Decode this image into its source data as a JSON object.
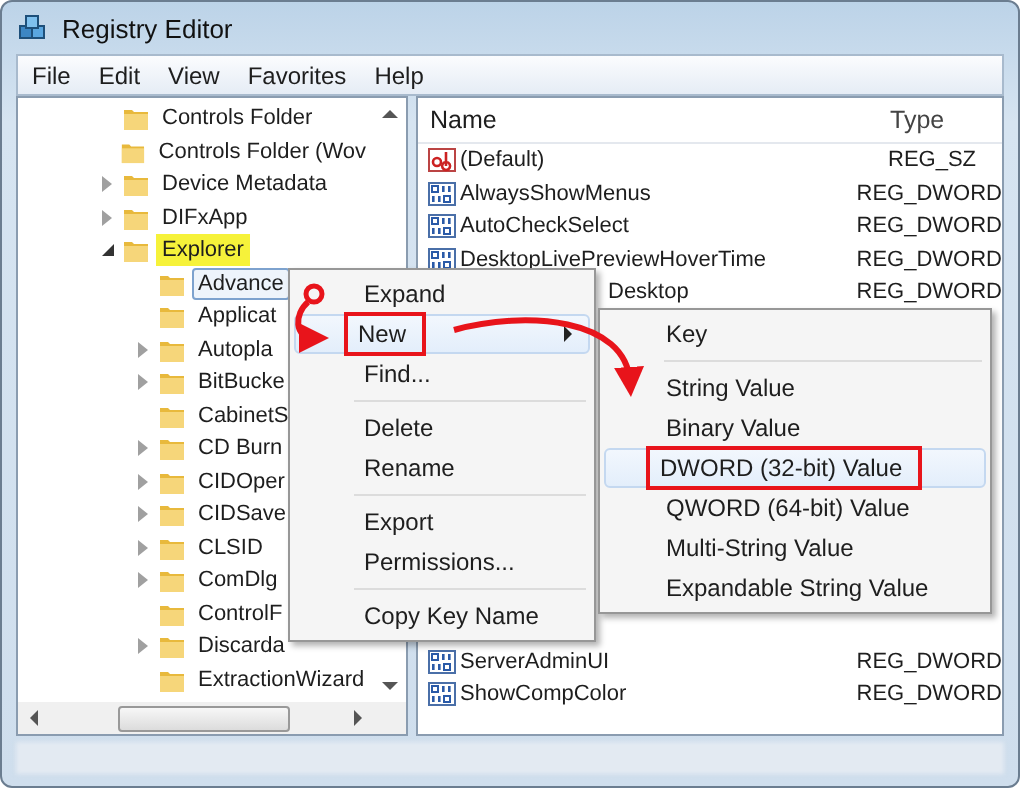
{
  "window": {
    "title": "Registry Editor"
  },
  "menu": [
    "File",
    "Edit",
    "View",
    "Favorites",
    "Help"
  ],
  "tree": [
    {
      "label": "Controls Folder",
      "has_children": false,
      "expanded": false,
      "selected": false,
      "highlighted": false
    },
    {
      "label": "Controls Folder (Wov",
      "has_children": false,
      "expanded": false,
      "selected": false,
      "highlighted": false
    },
    {
      "label": "Device Metadata",
      "has_children": true,
      "expanded": false,
      "selected": false,
      "highlighted": false
    },
    {
      "label": "DIFxApp",
      "has_children": true,
      "expanded": false,
      "selected": false,
      "highlighted": false
    },
    {
      "label": "Explorer",
      "has_children": true,
      "expanded": true,
      "selected": false,
      "highlighted": true,
      "children": [
        {
          "label": "Advance",
          "has_children": false,
          "expanded": false,
          "selected": true,
          "highlighted": false
        },
        {
          "label": "Applicat",
          "has_children": false,
          "expanded": false,
          "selected": false,
          "highlighted": false
        },
        {
          "label": "Autopla",
          "has_children": true,
          "expanded": false,
          "selected": false,
          "highlighted": false
        },
        {
          "label": "BitBucke",
          "has_children": true,
          "expanded": false,
          "selected": false,
          "highlighted": false
        },
        {
          "label": "CabinetS",
          "has_children": false,
          "expanded": false,
          "selected": false,
          "highlighted": false
        },
        {
          "label": "CD Burn",
          "has_children": true,
          "expanded": false,
          "selected": false,
          "highlighted": false
        },
        {
          "label": "CIDOper",
          "has_children": true,
          "expanded": false,
          "selected": false,
          "highlighted": false
        },
        {
          "label": "CIDSave",
          "has_children": true,
          "expanded": false,
          "selected": false,
          "highlighted": false
        },
        {
          "label": "CLSID",
          "has_children": true,
          "expanded": false,
          "selected": false,
          "highlighted": false
        },
        {
          "label": "ComDlg",
          "has_children": true,
          "expanded": false,
          "selected": false,
          "highlighted": false
        },
        {
          "label": "ControlF",
          "has_children": false,
          "expanded": false,
          "selected": false,
          "highlighted": false
        },
        {
          "label": "Discarda",
          "has_children": true,
          "expanded": false,
          "selected": false,
          "highlighted": false
        },
        {
          "label": "ExtractionWizard",
          "has_children": false,
          "expanded": false,
          "selected": false,
          "highlighted": false
        }
      ]
    }
  ],
  "list": {
    "columns": [
      "Name",
      "Type"
    ],
    "rows": [
      {
        "name": "(Default)",
        "type": "REG_SZ",
        "kind": "string"
      },
      {
        "name": "AlwaysShowMenus",
        "type": "REG_DWORD",
        "kind": "binary"
      },
      {
        "name": "AutoCheckSelect",
        "type": "REG_DWORD",
        "kind": "binary"
      },
      {
        "name": "DesktopLivePreviewHoverTime",
        "type": "REG_DWORD",
        "kind": "binary"
      },
      {
        "name": "Desktop",
        "type": "REG_DWORD",
        "kind": "partial"
      },
      {
        "kind": "hidden"
      },
      {
        "name": "ServerAdminUI",
        "type": "REG_DWORD",
        "kind": "binary"
      },
      {
        "name": "ShowCompColor",
        "type": "REG_DWORD",
        "kind": "binary"
      }
    ]
  },
  "context_menu": [
    {
      "kind": "item",
      "label": "Expand",
      "submenu": false,
      "selected": false,
      "annotated": false
    },
    {
      "kind": "item",
      "label": "New",
      "submenu": true,
      "selected": true,
      "annotated": true
    },
    {
      "kind": "item",
      "label": "Find...",
      "submenu": false,
      "selected": false,
      "annotated": false
    },
    {
      "kind": "separator"
    },
    {
      "kind": "item",
      "label": "Delete",
      "submenu": false,
      "selected": false,
      "annotated": false
    },
    {
      "kind": "item",
      "label": "Rename",
      "submenu": false,
      "selected": false,
      "annotated": false
    },
    {
      "kind": "separator"
    },
    {
      "kind": "item",
      "label": "Export",
      "submenu": false,
      "selected": false,
      "annotated": false
    },
    {
      "kind": "item",
      "label": "Permissions...",
      "submenu": false,
      "selected": false,
      "annotated": false
    },
    {
      "kind": "separator"
    },
    {
      "kind": "item",
      "label": "Copy Key Name",
      "submenu": false,
      "selected": false,
      "annotated": false
    }
  ],
  "submenu": [
    {
      "kind": "item",
      "label": "Key",
      "selected": false,
      "annotated": false
    },
    {
      "kind": "separator"
    },
    {
      "kind": "item",
      "label": "String Value",
      "selected": false,
      "annotated": false
    },
    {
      "kind": "item",
      "label": "Binary Value",
      "selected": false,
      "annotated": false
    },
    {
      "kind": "item",
      "label": "DWORD (32-bit) Value",
      "selected": true,
      "annotated": true
    },
    {
      "kind": "item",
      "label": "QWORD (64-bit) Value",
      "selected": false,
      "annotated": false
    },
    {
      "kind": "item",
      "label": "Multi-String Value",
      "selected": false,
      "annotated": false
    },
    {
      "kind": "item",
      "label": "Expandable String Value",
      "selected": false,
      "annotated": false
    }
  ]
}
